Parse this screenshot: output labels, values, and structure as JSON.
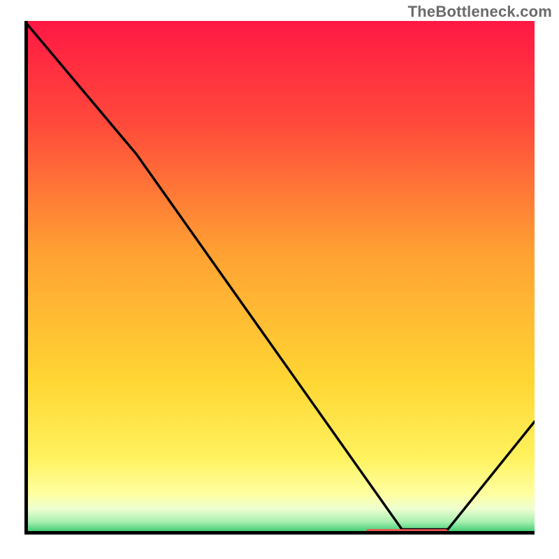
{
  "watermark": "TheBottleneck.com",
  "chart_data": {
    "type": "line",
    "title": "",
    "xlabel": "",
    "ylabel": "",
    "xlim": [
      0,
      100
    ],
    "ylim": [
      0,
      100
    ],
    "series": [
      {
        "name": "bottleneck-curve",
        "x": [
          0,
          22,
          74,
          83,
          100
        ],
        "y": [
          100,
          74,
          1,
          1,
          22
        ]
      }
    ],
    "marker_segment": {
      "name": "optimal-range-marker",
      "color": "#ef5350",
      "x_start": 67,
      "x_end": 83,
      "y": 0.5
    },
    "background_gradient": {
      "stops": [
        {
          "offset": 0.0,
          "color": "#ff1844"
        },
        {
          "offset": 0.2,
          "color": "#ff4a3b"
        },
        {
          "offset": 0.45,
          "color": "#ffa133"
        },
        {
          "offset": 0.7,
          "color": "#ffd633"
        },
        {
          "offset": 0.85,
          "color": "#fff25e"
        },
        {
          "offset": 0.92,
          "color": "#ffffa0"
        },
        {
          "offset": 0.95,
          "color": "#eeffcf"
        },
        {
          "offset": 0.975,
          "color": "#a8f0b0"
        },
        {
          "offset": 1.0,
          "color": "#20c060"
        }
      ]
    }
  }
}
